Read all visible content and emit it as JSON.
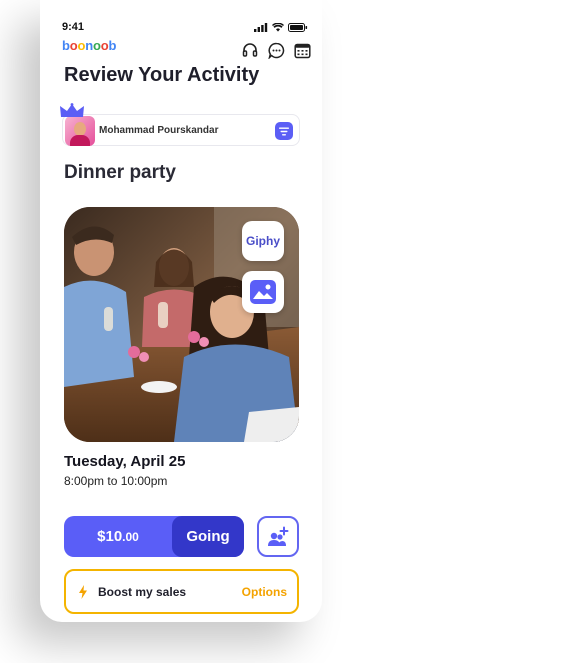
{
  "status": {
    "time": "9:41"
  },
  "logo": {
    "parts": [
      "b",
      "o",
      "o",
      "n",
      "o",
      "o",
      "b"
    ],
    "colors": [
      "#4285F4",
      "#EA4335",
      "#FBBC05",
      "#4285F4",
      "#34A853",
      "#EA4335",
      "#4285F4"
    ]
  },
  "header": {
    "title": "Review Your Activity",
    "icons": [
      "headphones-icon",
      "chat-icon",
      "calendar-icon"
    ]
  },
  "profile": {
    "name": "Mohammad Pourskandar"
  },
  "event": {
    "title": "Dinner party",
    "date": "Tuesday, April 25",
    "time_range": "8:00pm to 10:00pm",
    "giphy_label": "Giphy"
  },
  "cta": {
    "price_main": "$10",
    "price_cents": ".00",
    "going_label": "Going"
  },
  "boost": {
    "label": "Boost my sales",
    "options_label": "Options"
  },
  "colors": {
    "accent": "#5a5ef7",
    "accent_dark": "#3337c9",
    "boost": "#f4b400"
  }
}
